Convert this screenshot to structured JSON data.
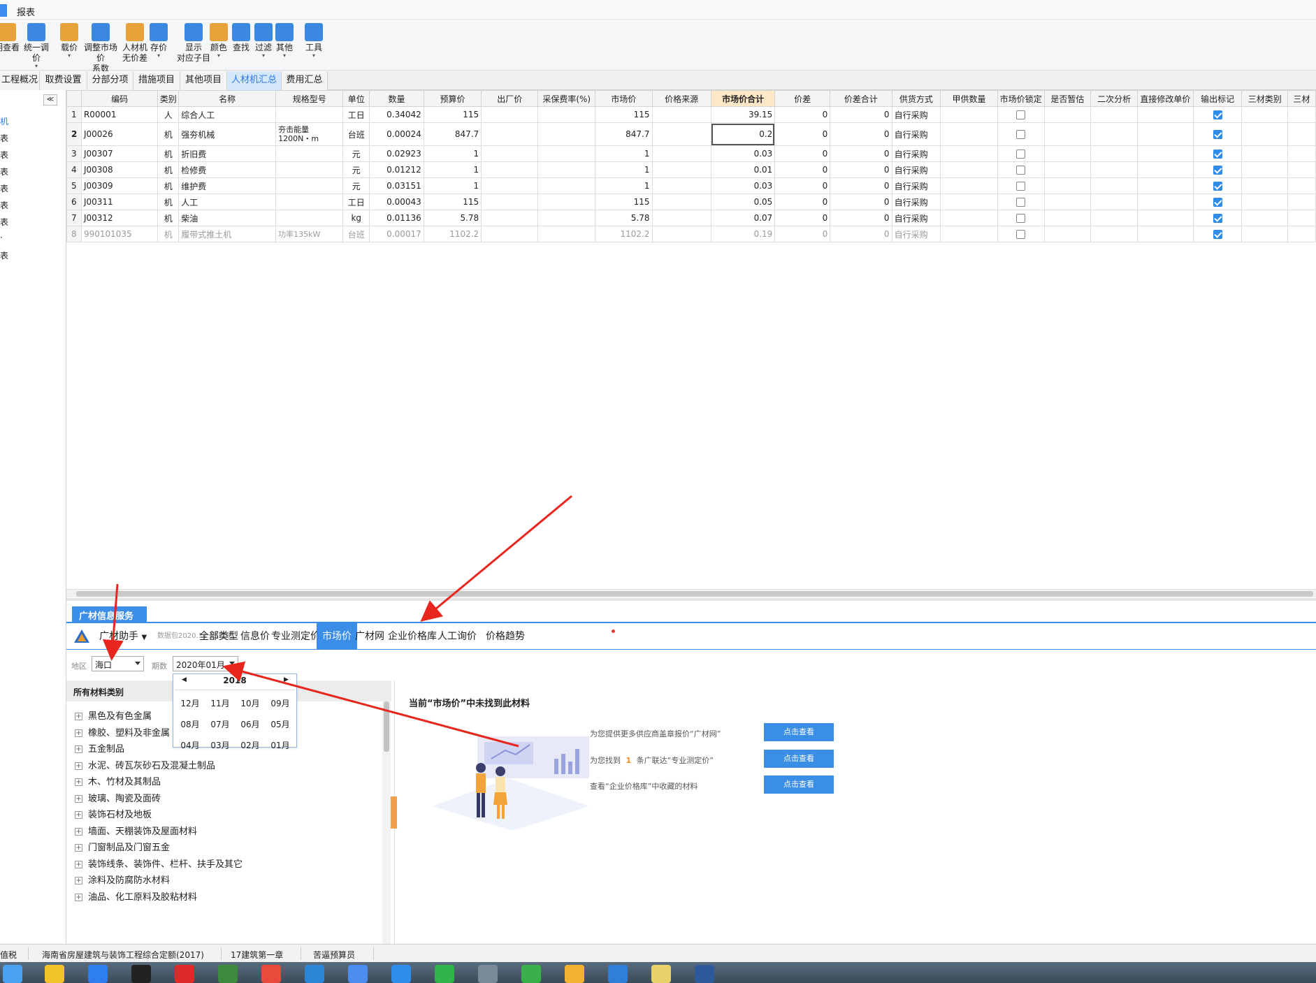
{
  "menu": {
    "reports": "报表"
  },
  "toolbar": {
    "items": [
      {
        "label": "明查看",
        "label2": "",
        "icon": "view-icon"
      },
      {
        "label": "统一调价",
        "label2": "",
        "icon": "adjust-price-icon"
      },
      {
        "label": "载价",
        "label2": "",
        "icon": "load-price-icon"
      },
      {
        "label": "调整市场价",
        "label2": "系数",
        "icon": "market-coefficient-icon"
      },
      {
        "label": "人材机",
        "label2": "无价差",
        "icon": "balance-icon"
      },
      {
        "label": "存价",
        "label2": "",
        "icon": "save-price-icon"
      },
      {
        "label": "显示",
        "label2": "对应子目",
        "icon": "show-items-icon"
      },
      {
        "label": "颜色",
        "label2": "",
        "icon": "color-icon"
      },
      {
        "label": "查找",
        "label2": "",
        "icon": "binoculars-icon"
      },
      {
        "label": "过滤",
        "label2": "",
        "icon": "filter-icon"
      },
      {
        "label": "其他",
        "label2": "",
        "icon": "grid-icon"
      },
      {
        "label": "工具",
        "label2": "",
        "icon": "tools-icon"
      }
    ]
  },
  "tabs": [
    "工程概况",
    "取费设置",
    "分部分项",
    "措施项目",
    "其他项目",
    "人材机汇总",
    "费用汇总"
  ],
  "active_tab": "人材机汇总",
  "sidebar": {
    "collapse": "≪",
    "items": [
      "机",
      "表",
      "表",
      "表",
      "表",
      "表",
      "表",
      "·",
      "表"
    ]
  },
  "grid": {
    "columns": [
      "",
      "编码",
      "类别",
      "名称",
      "规格型号",
      "单位",
      "数量",
      "预算价",
      "出厂价",
      "采保费率(%)",
      "市场价",
      "价格来源",
      "市场价合计",
      "价差",
      "价差合计",
      "供货方式",
      "甲供数量",
      "市场价锁定",
      "是否暂估",
      "二次分析",
      "直接修改单价",
      "输出标记",
      "三材类别",
      "三材"
    ],
    "rows": [
      {
        "n": "1",
        "code": "R00001",
        "cat": "人",
        "name": "综合人工",
        "spec": "",
        "spec2": "",
        "unit": "工日",
        "qty": "0.34042",
        "budget": "115",
        "market": "115",
        "total": "39.15",
        "diff": "0",
        "diff_total": "0",
        "supply": "自行采购",
        "lock": false,
        "output": true
      },
      {
        "n": "2",
        "code": "J00026",
        "cat": "机",
        "name": "强夯机械",
        "spec": "夯击能量",
        "spec2": "1200N・m",
        "unit": "台班",
        "qty": "0.00024",
        "budget": "847.7",
        "market": "847.7",
        "total": "0.2",
        "diff": "0",
        "diff_total": "0",
        "supply": "自行采购",
        "lock": false,
        "output": true
      },
      {
        "n": "3",
        "code": "J00307",
        "cat": "机",
        "name": "折旧费",
        "spec": "",
        "spec2": "",
        "unit": "元",
        "qty": "0.02923",
        "budget": "1",
        "market": "1",
        "total": "0.03",
        "diff": "0",
        "diff_total": "0",
        "supply": "自行采购",
        "lock": false,
        "output": true
      },
      {
        "n": "4",
        "code": "J00308",
        "cat": "机",
        "name": "检修费",
        "spec": "",
        "spec2": "",
        "unit": "元",
        "qty": "0.01212",
        "budget": "1",
        "market": "1",
        "total": "0.01",
        "diff": "0",
        "diff_total": "0",
        "supply": "自行采购",
        "lock": false,
        "output": true
      },
      {
        "n": "5",
        "code": "J00309",
        "cat": "机",
        "name": "维护费",
        "spec": "",
        "spec2": "",
        "unit": "元",
        "qty": "0.03151",
        "budget": "1",
        "market": "1",
        "total": "0.03",
        "diff": "0",
        "diff_total": "0",
        "supply": "自行采购",
        "lock": false,
        "output": true
      },
      {
        "n": "6",
        "code": "J00311",
        "cat": "机",
        "name": "人工",
        "spec": "",
        "spec2": "",
        "unit": "工日",
        "qty": "0.00043",
        "budget": "115",
        "market": "115",
        "total": "0.05",
        "diff": "0",
        "diff_total": "0",
        "supply": "自行采购",
        "lock": false,
        "output": true
      },
      {
        "n": "7",
        "code": "J00312",
        "cat": "机",
        "name": "柴油",
        "spec": "",
        "spec2": "",
        "unit": "kg",
        "qty": "0.01136",
        "budget": "5.78",
        "market": "5.78",
        "total": "0.07",
        "diff": "0",
        "diff_total": "0",
        "supply": "自行采购",
        "lock": false,
        "output": true
      },
      {
        "n": "8",
        "code": "990101035",
        "cat": "机",
        "name": "履带式推土机",
        "spec": "功率135kW",
        "spec2": "",
        "unit": "台班",
        "qty": "0.00017",
        "budget": "1102.2",
        "market": "1102.2",
        "total": "0.19",
        "diff": "0",
        "diff_total": "0",
        "supply": "自行采购",
        "lock": false,
        "output": true
      }
    ]
  },
  "service": {
    "tab_label": "广材信息服务",
    "assistant": "广材助手",
    "package_note": "数据包2020.11.15到期",
    "nav": [
      "全部类型",
      "信息价",
      "专业测定价",
      "市场价",
      "广材网",
      "企业价格库",
      "人工询价",
      "价格趋势"
    ],
    "active_nav": "市场价",
    "region_label": "地区",
    "region_value": "海口",
    "period_label": "期数",
    "period_value": "2020年01月"
  },
  "picker": {
    "year": "2018",
    "months": [
      "12月",
      "11月",
      "10月",
      "09月",
      "08月",
      "07月",
      "06月",
      "05月",
      "04月",
      "03月",
      "02月",
      "01月"
    ]
  },
  "categories": {
    "header": "所有材料类别",
    "items": [
      "黑色及有色金属",
      "橡胶、塑料及非金属",
      "五金制品",
      "水泥、砖瓦灰砂石及混凝土制品",
      "木、竹材及其制品",
      "玻璃、陶瓷及面砖",
      "装饰石材及地板",
      "墙面、天棚装饰及屋面材料",
      "门窗制品及门窗五金",
      "装饰线条、装饰件、栏杆、扶手及其它",
      "涂料及防腐防水材料",
      "油品、化工原料及胶粘材料"
    ]
  },
  "not_found": {
    "title": "当前“市场价”中未找到此材料",
    "line1": "为您提供更多供应商盖章报价“广材网”",
    "line2_pre": "为您找到",
    "line2_num": "1",
    "line2_post": "条广联达“专业测定价”",
    "line3": "查看“企业价格库”中收藏的材料",
    "button": "点击查看"
  },
  "statusbar": [
    "值税",
    "海南省房屋建筑与装饰工程综合定额(2017)",
    "17建筑第一章",
    "苦逼预算员"
  ],
  "taskbar_icons": [
    "baidu-netdisk-icon",
    "speedometer-icon",
    "browser-icon",
    "qq-icon",
    "netease-music-icon",
    "vim-icon",
    "chrome-icon",
    "ie-icon",
    "feishu-icon",
    "tim-icon",
    "wechat-icon",
    "calculator-icon",
    "refresh-app-icon",
    "glodon-icon",
    "preview-icon",
    "notes-icon",
    "cad-icon"
  ],
  "colors": {
    "accent": "#3b8ee8",
    "active_tab_bg": "#d4e7fb",
    "highlight_header": "#fde9c8",
    "arrow": "#e8261e"
  }
}
